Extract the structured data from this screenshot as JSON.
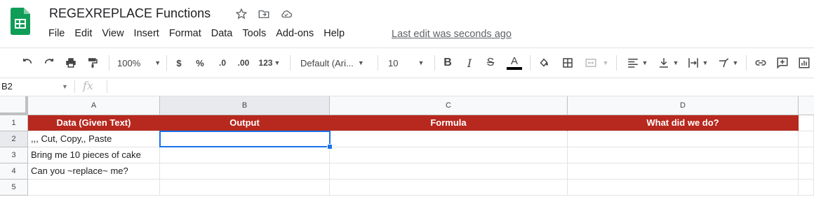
{
  "document": {
    "title": "REGEXREPLACE Functions",
    "last_edit": "Last edit was seconds ago"
  },
  "menu": [
    "File",
    "Edit",
    "View",
    "Insert",
    "Format",
    "Data",
    "Tools",
    "Add-ons",
    "Help"
  ],
  "toolbar": {
    "zoom": "100%",
    "currency": "$",
    "percent": "%",
    "decrease_decimal": ".0",
    "increase_decimal": ".00",
    "number_format": "123",
    "font": "Default (Ari...",
    "font_size": "10",
    "bold": "B",
    "italic": "I",
    "strike": "S",
    "text_color": "A"
  },
  "formula_bar": {
    "name_box": "B2",
    "fx": "fx",
    "value": ""
  },
  "sheet": {
    "columns": [
      "A",
      "B",
      "C",
      "D"
    ],
    "rows": [
      "1",
      "2",
      "3",
      "4",
      "5"
    ],
    "header_row": [
      "Data (Given Text)",
      "Output",
      "Formula",
      "What did we do?"
    ],
    "data_rows": [
      [
        ",,, Cut, Copy,, Paste",
        "",
        "",
        ""
      ],
      [
        "Bring me 10 pieces of cake",
        "",
        "",
        ""
      ],
      [
        "Can you ~replace~ me?",
        "",
        "",
        ""
      ],
      [
        "",
        "",
        "",
        ""
      ]
    ],
    "selected_cell": "B2",
    "header_fill": "#b7281e",
    "accent": "#1a73e8"
  }
}
